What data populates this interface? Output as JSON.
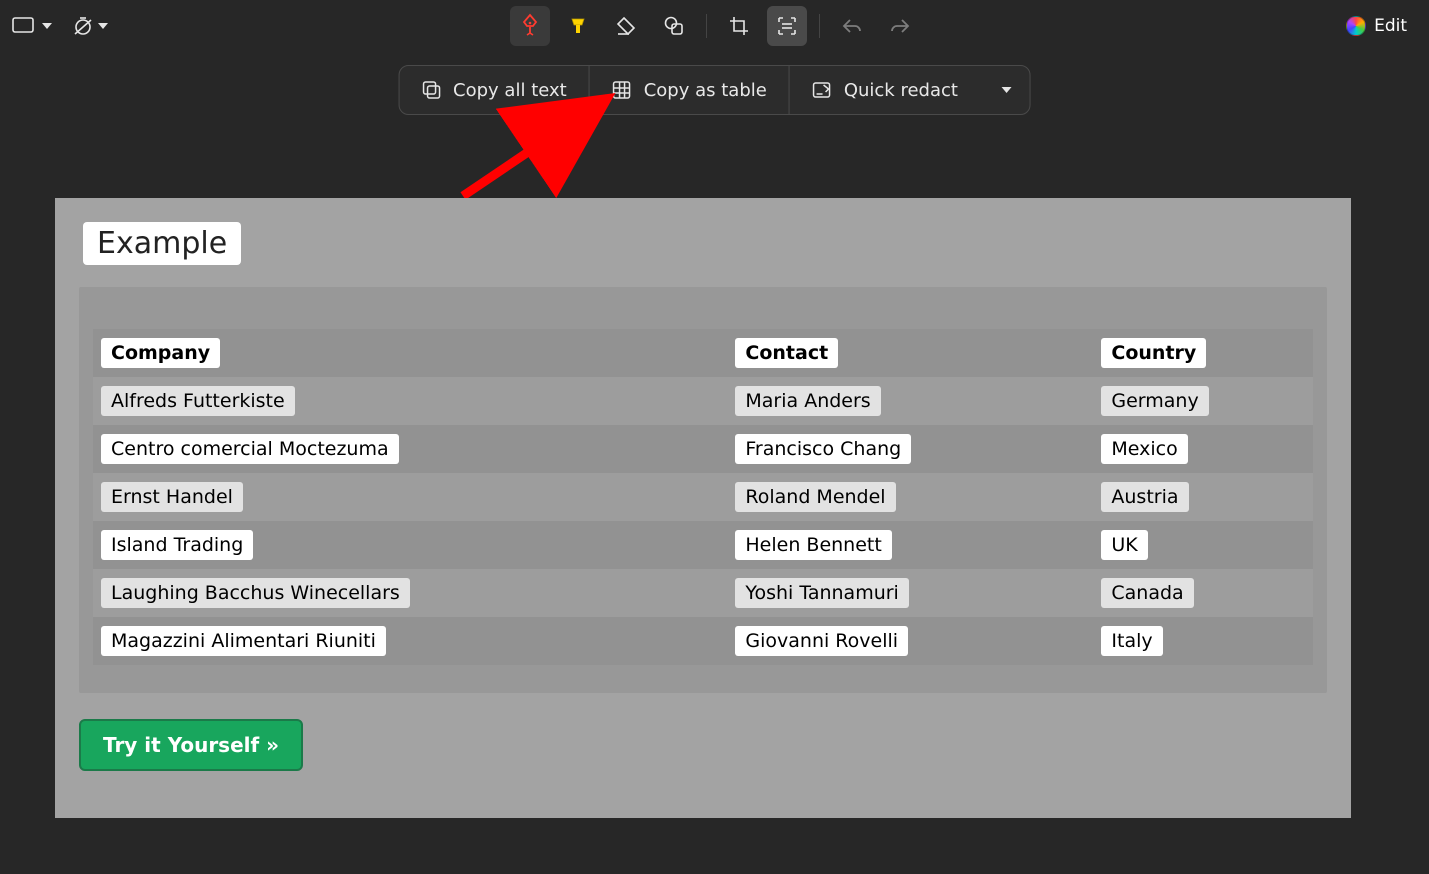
{
  "toolbar": {
    "edit_label": "Edit"
  },
  "action_bar": {
    "copy_all_text": "Copy all text",
    "copy_as_table": "Copy as table",
    "quick_redact": "Quick redact"
  },
  "content": {
    "example_heading": "Example",
    "try_button": "Try it Yourself »",
    "table": {
      "headers": {
        "company": "Company",
        "contact": "Contact",
        "country": "Country"
      },
      "rows": [
        {
          "company": "Alfreds Futterkiste",
          "contact": "Maria Anders",
          "country": "Germany"
        },
        {
          "company": "Centro comercial Moctezuma",
          "contact": "Francisco Chang",
          "country": "Mexico"
        },
        {
          "company": "Ernst Handel",
          "contact": "Roland Mendel",
          "country": "Austria"
        },
        {
          "company": "Island Trading",
          "contact": "Helen Bennett",
          "country": "UK"
        },
        {
          "company": "Laughing Bacchus Winecellars",
          "contact": "Yoshi Tannamuri",
          "country": "Canada"
        },
        {
          "company": "Magazzini Alimentari Riuniti",
          "contact": "Giovanni Rovelli",
          "country": "Italy"
        }
      ]
    }
  }
}
